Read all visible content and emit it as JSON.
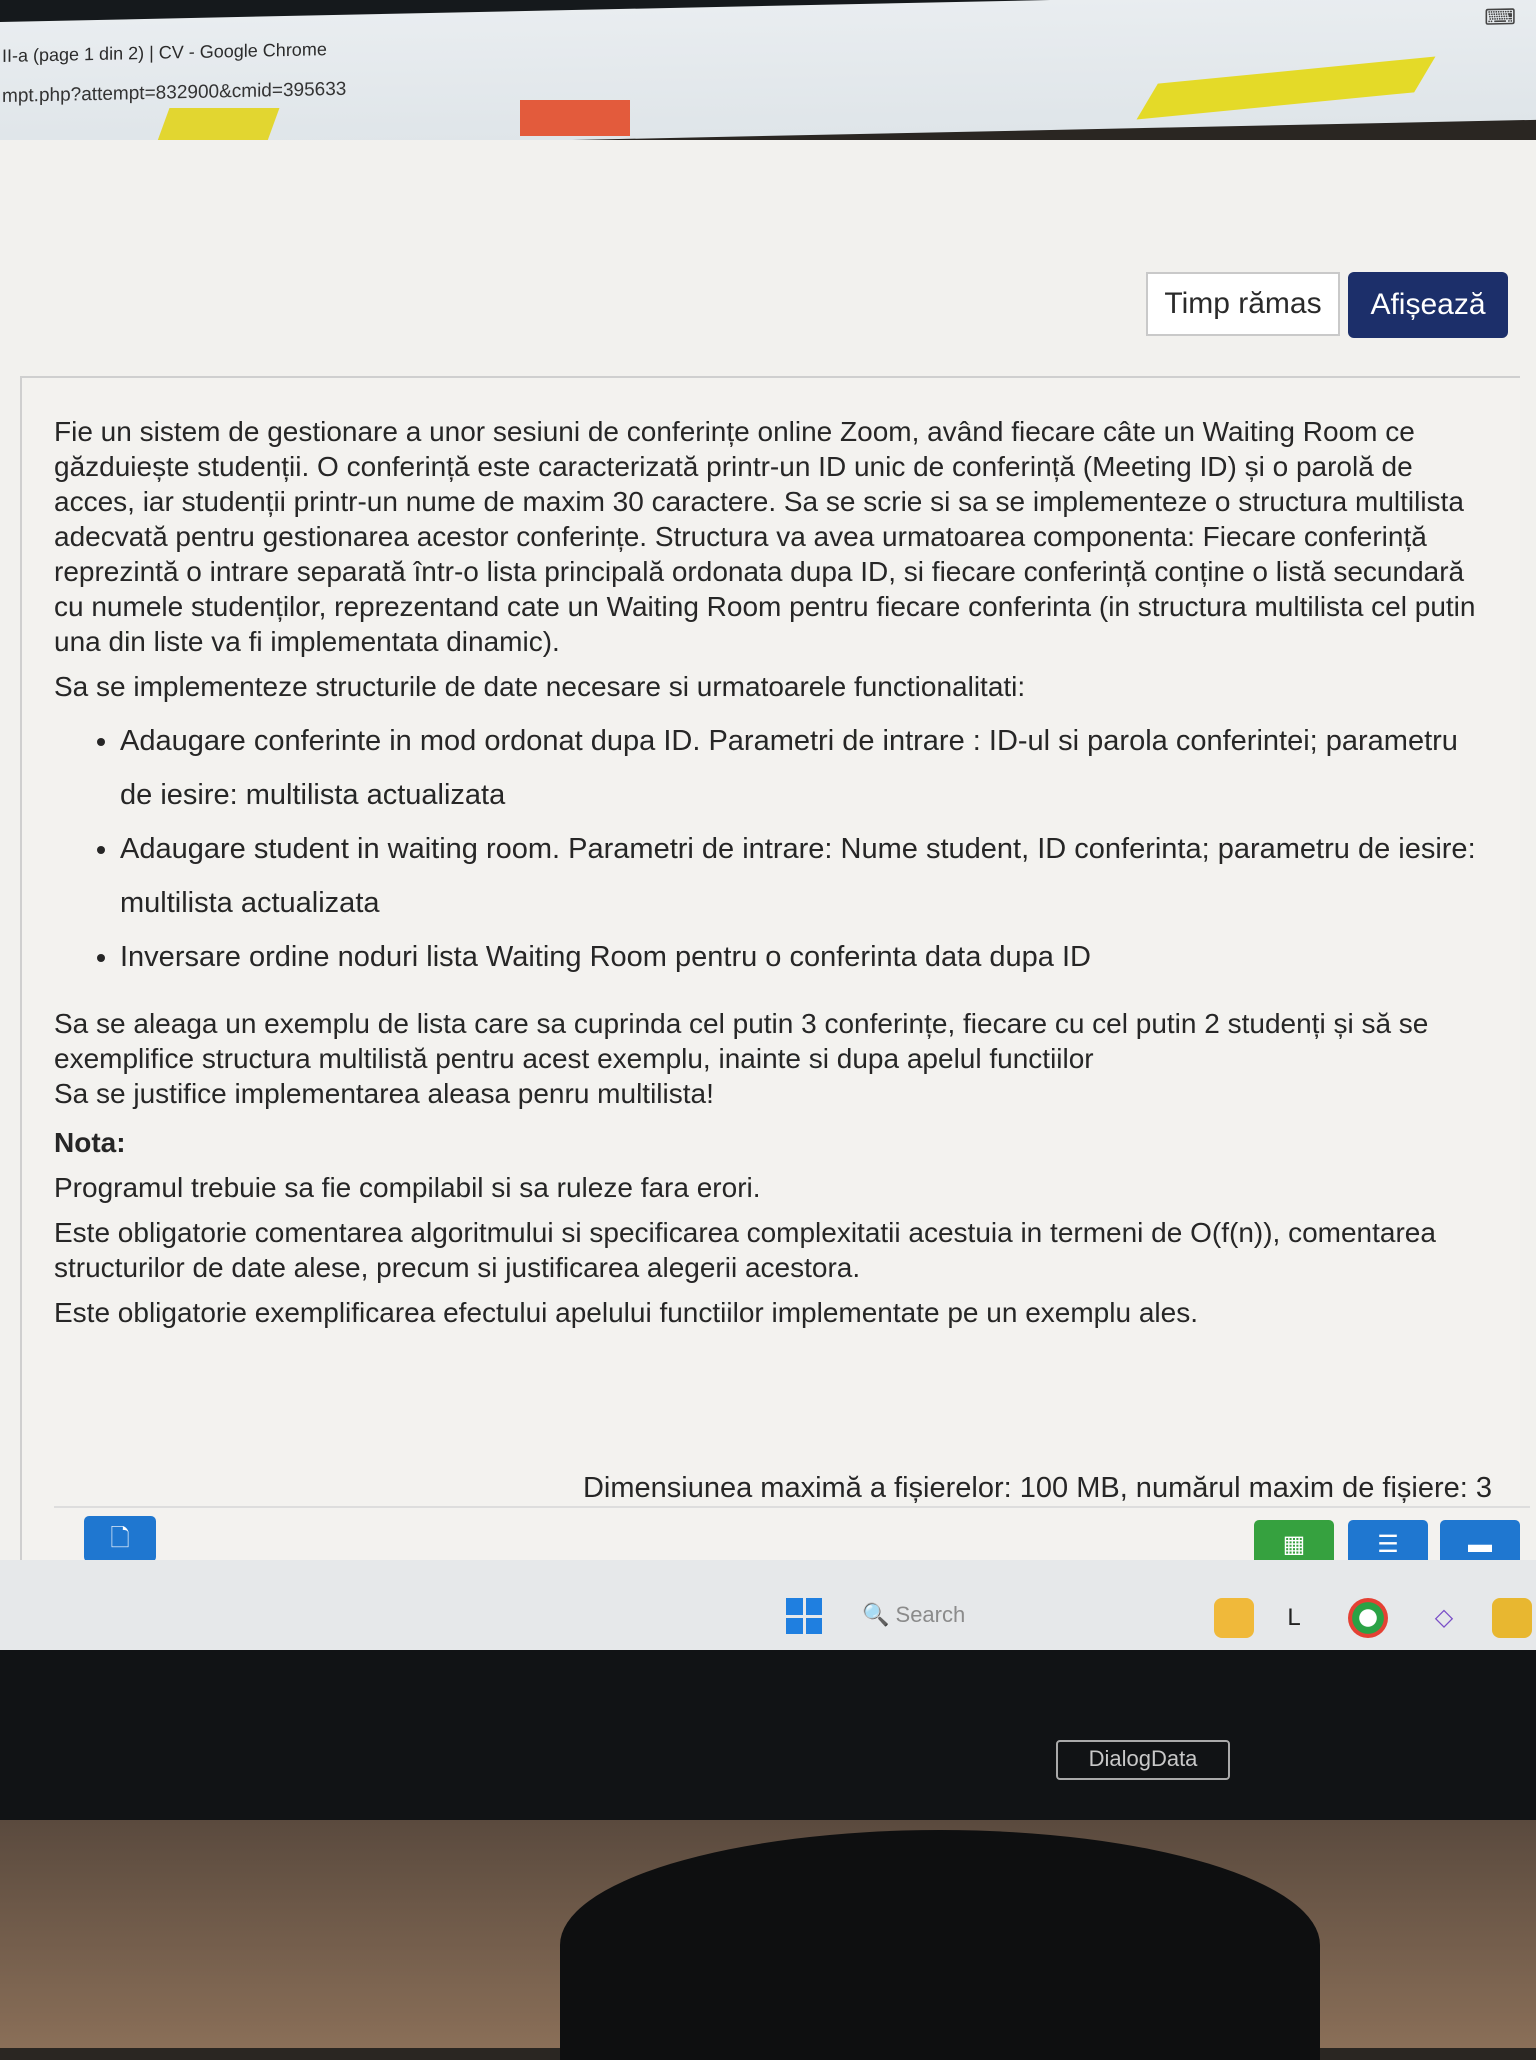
{
  "browser": {
    "title": "II-a (page 1 din 2) | CV - Google Chrome",
    "url": "mpt.php?attempt=832900&cmid=395633"
  },
  "timer": {
    "label": "Timp rămas",
    "show_button": "Afișează"
  },
  "question": {
    "intro": "Fie un sistem de gestionare a unor sesiuni de conferințe online Zoom, având fiecare câte un Waiting Room ce găzduiește studenții. O conferință este caracterizată printr-un ID unic de conferință (Meeting ID) și o parolă de acces, iar studenții printr-un nume de maxim 30 caractere. Sa se scrie si sa se implementeze o structura multilista adecvată pentru gestionarea acestor conferințe. Structura va avea urmatoarea componenta: Fiecare conferință reprezintă o intrare separată într-o lista principală ordonata dupa ID, si fiecare conferință conține o listă secundară cu numele studenților, reprezentand cate un Waiting Room pentru fiecare conferinta (in structura multilista cel putin una din liste va fi implementata dinamic).",
    "requirements_intro": "Sa se implementeze structurile de date necesare si urmatoarele functionalitati:",
    "bullets": [
      "Adaugare conferinte in mod ordonat dupa ID. Parametri de intrare : ID-ul si parola conferintei; parametru de iesire: multilista actualizata",
      "Adaugare student in waiting room. Parametri de intrare: Nume student, ID conferinta; parametru de iesire: multilista actualizata",
      "Inversare ordine noduri lista Waiting Room pentru o conferinta data dupa ID"
    ],
    "example": "Sa se aleaga un exemplu de lista care sa cuprinda cel putin 3 conferințe, fiecare cu cel putin 2 studenți și să se exemplifice structura multilistă pentru acest exemplu, inainte si dupa apelul functiilor",
    "justify": "Sa se justifice implementarea aleasa penru multilista!",
    "nota_label": "Nota:",
    "nota_1": "Programul trebuie sa fie compilabil si sa ruleze fara erori.",
    "nota_2": "Este obligatorie comentarea algoritmului si specificarea complexitatii acestuia in termeni de O(f(n)), comentarea structurilor de date alese, precum si justificarea alegerii acestora.",
    "nota_3": "Este obligatorie exemplificarea efectului apelului functiilor implementate pe un exemplu ales.",
    "file_limit": "Dimensiunea maximă a fișierelor: 100 MB, numărul maxim de fișiere: 3"
  },
  "taskbar": {
    "search_placeholder": "Search"
  },
  "monitor": {
    "brand": "DialogData"
  },
  "icons": {
    "file": "file-icon",
    "grid": "grid-icon",
    "list": "list-icon",
    "folder": "folder-icon"
  }
}
